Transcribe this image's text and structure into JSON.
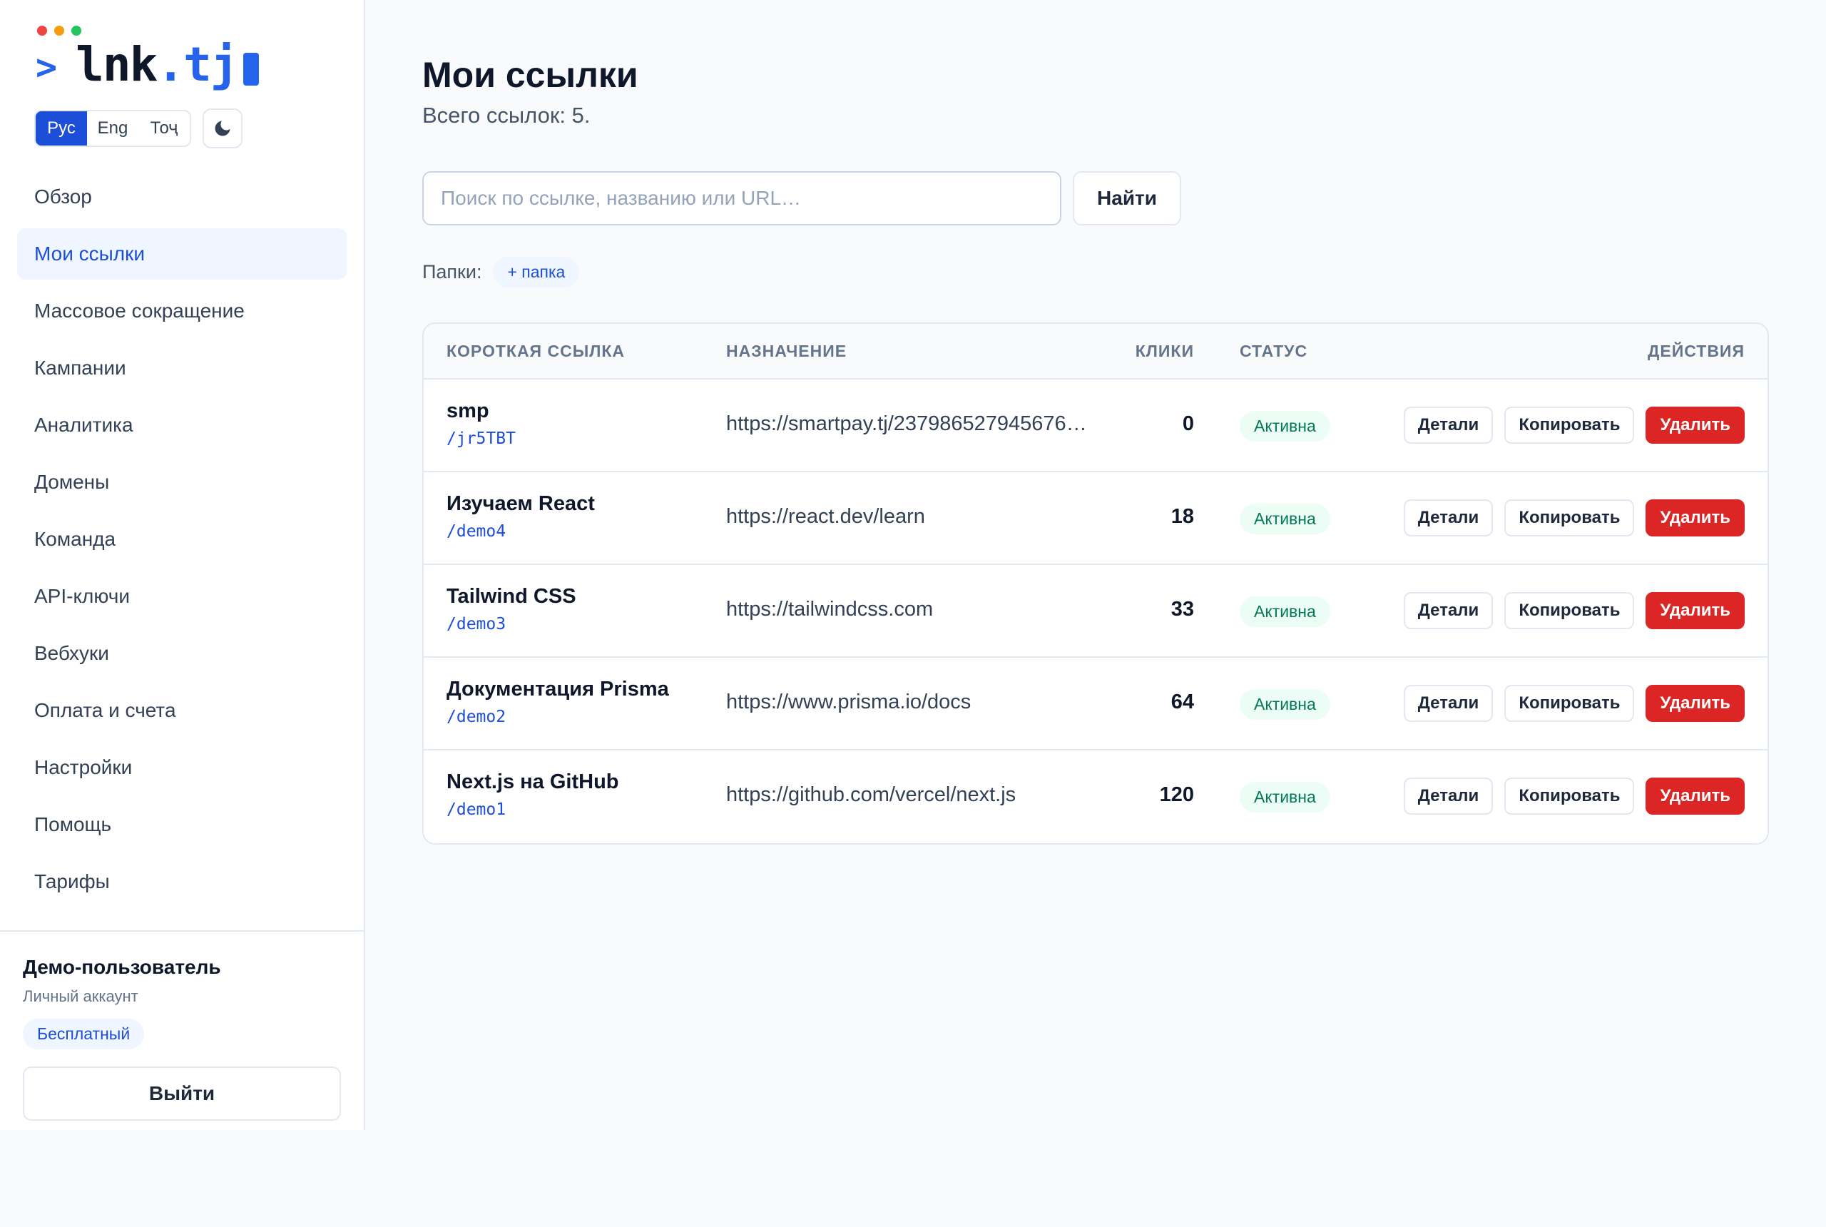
{
  "app": {
    "logo_prompt": ">",
    "logo_name": "lnk",
    "logo_tld": ".tj",
    "window_dot_colors": [
      "#ef4444",
      "#f59e0b",
      "#22c55e"
    ],
    "accent_color": "#1d4ed8"
  },
  "languages": [
    {
      "label": "Рус",
      "active": true
    },
    {
      "label": "Eng",
      "active": false
    },
    {
      "label": "Тоҷ",
      "active": false
    }
  ],
  "theme_toggle_icon": "moon-icon",
  "nav": [
    {
      "label": "Обзор",
      "active": false
    },
    {
      "label": "Мои ссылки",
      "active": true
    },
    {
      "label": "Массовое сокращение",
      "active": false
    },
    {
      "label": "Кампании",
      "active": false
    },
    {
      "label": "Аналитика",
      "active": false
    },
    {
      "label": "Домены",
      "active": false
    },
    {
      "label": "Команда",
      "active": false
    },
    {
      "label": "API-ключи",
      "active": false
    },
    {
      "label": "Вебхуки",
      "active": false
    },
    {
      "label": "Оплата и счета",
      "active": false
    },
    {
      "label": "Настройки",
      "active": false
    },
    {
      "label": "Помощь",
      "active": false
    },
    {
      "label": "Тарифы",
      "active": false
    }
  ],
  "account": {
    "name": "Демо-пользователь",
    "type": "Личный аккаунт",
    "plan": "Бесплатный",
    "logout_label": "Выйти"
  },
  "page": {
    "title": "Мои ссылки",
    "subtitle": "Всего ссылок: 5."
  },
  "search": {
    "value": "",
    "placeholder": "Поиск по ссылке, названию или URL…",
    "button_label": "Найти"
  },
  "folders": {
    "label": "Папки:",
    "add_label": "+ папка"
  },
  "table": {
    "headers": {
      "short": "КОРОТКАЯ ССЫЛКА",
      "destination": "НАЗНАЧЕНИЕ",
      "clicks": "КЛИКИ",
      "status": "СТАТУС",
      "actions": "ДЕЙСТВИЯ"
    },
    "action_labels": {
      "details": "Детали",
      "copy": "Копировать",
      "delete": "Удалить"
    },
    "rows": [
      {
        "title": "smp",
        "slug": "/jr5TBT",
        "destination": "https://smartpay.tj/237986527945676…",
        "clicks": "0",
        "status": "Активна"
      },
      {
        "title": "Изучаем React",
        "slug": "/demo4",
        "destination": "https://react.dev/learn",
        "clicks": "18",
        "status": "Активна"
      },
      {
        "title": "Tailwind CSS",
        "slug": "/demo3",
        "destination": "https://tailwindcss.com",
        "clicks": "33",
        "status": "Активна"
      },
      {
        "title": "Документация Prisma",
        "slug": "/demo2",
        "destination": "https://www.prisma.io/docs",
        "clicks": "64",
        "status": "Активна"
      },
      {
        "title": "Next.js на GitHub",
        "slug": "/demo1",
        "destination": "https://github.com/vercel/next.js",
        "clicks": "120",
        "status": "Активна"
      }
    ]
  }
}
